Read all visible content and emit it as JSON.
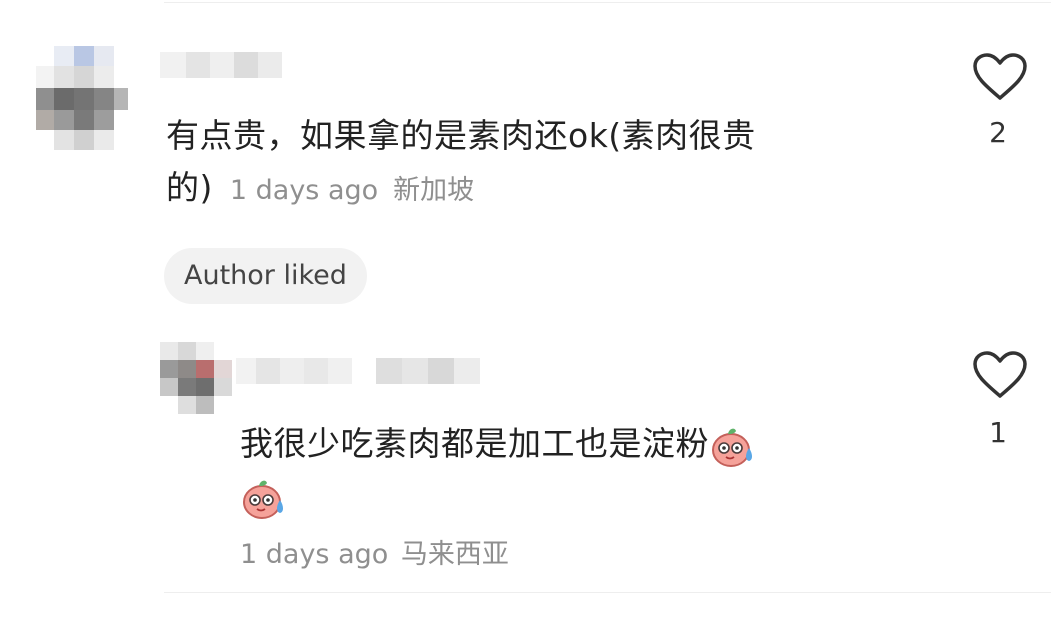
{
  "comments": [
    {
      "text_line1": "有点贵，如果拿的是素肉还ok(素肉很贵",
      "text_line2": "的)",
      "time": "1 days ago",
      "location": "新加坡",
      "author_liked_label": "Author liked",
      "like_count": "2"
    }
  ],
  "replies": [
    {
      "text": "我很少吃素肉都是加工也是淀粉",
      "time": "1 days ago",
      "location": "马来西亚",
      "like_count": "1"
    }
  ],
  "icons": {
    "like": "heart-outline-icon",
    "emoji": "sweat-smile-emoji"
  },
  "colors": {
    "text": "#222222",
    "meta": "#8f8f8f",
    "chip_bg": "#f2f2f2",
    "divider": "#eeeeee"
  }
}
